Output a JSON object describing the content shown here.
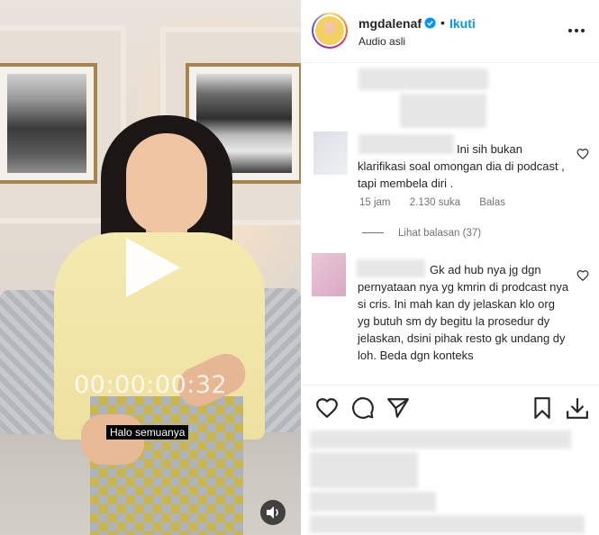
{
  "video": {
    "timecode": "00:00:00:32",
    "subtitle": "Halo semuanya",
    "icons": {
      "play": "play-icon",
      "audio": "speaker-icon"
    }
  },
  "header": {
    "username": "mgdalenaf",
    "verified": true,
    "separator": "•",
    "follow_label": "Ikuti",
    "audio_label": "Audio asli",
    "accent_color": "#0095f6"
  },
  "comments": [
    {
      "text": "Ini sih bukan klarifikasi soal omongan dia di podcast , tapi membela diri .",
      "time": "15 jam",
      "likes": "2.130 suka",
      "reply_label": "Balas"
    },
    {
      "text": "Gk ad hub nya jg dgn pernyataan nya yg kmrin di prodcast nya si cris. Ini mah kan dy jelaskan klo org yg butuh sm dy begitu la prosedur dy jelaskan, dsini pihak resto gk undang dy loh. Beda dgn konteks"
    }
  ],
  "view_replies_label": "Lihat balasan (37)",
  "actions": [
    "heart-icon",
    "comment-icon",
    "share-icon",
    "bookmark-icon",
    "download-icon"
  ]
}
